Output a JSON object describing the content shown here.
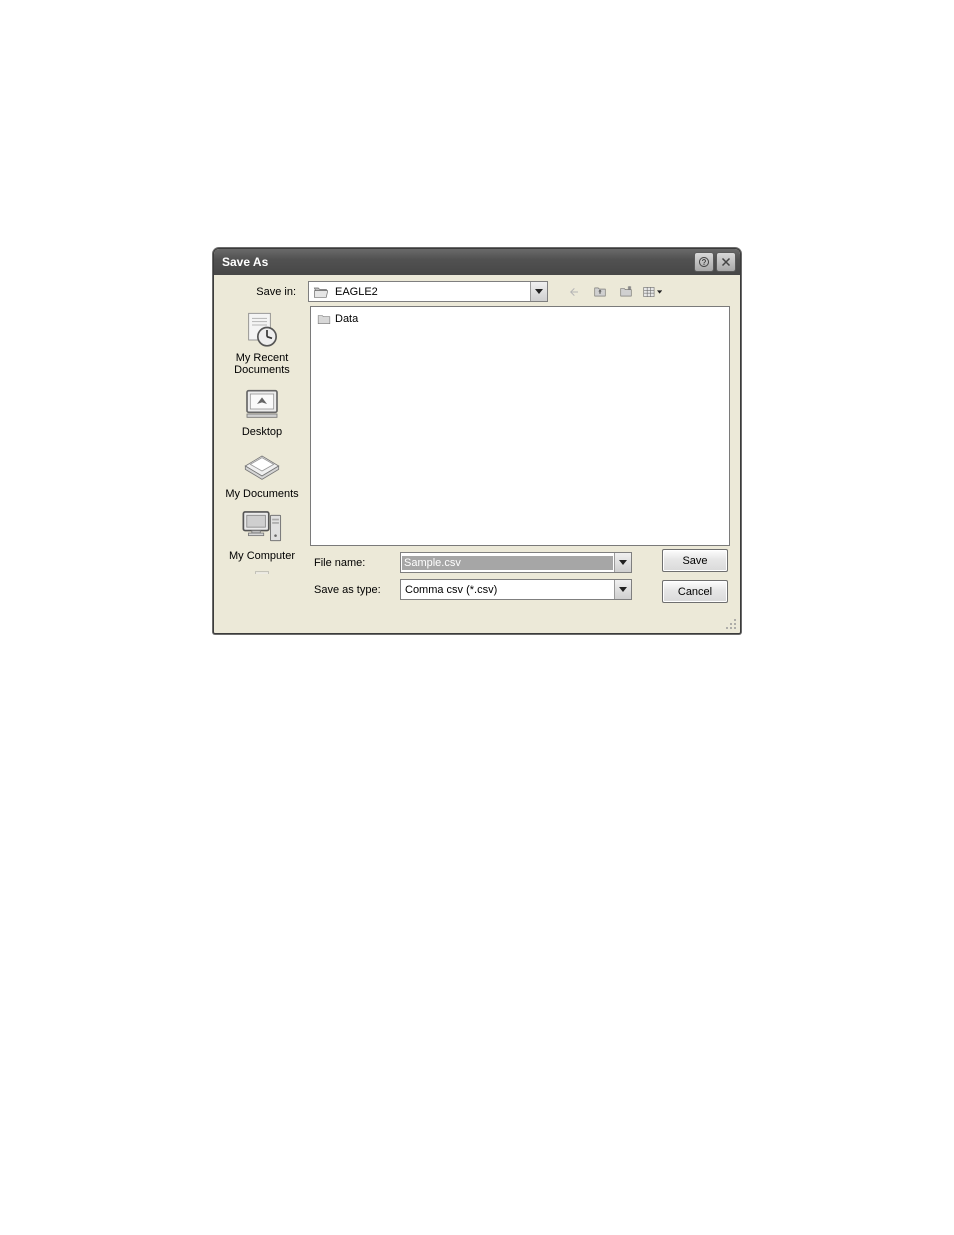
{
  "dialog": {
    "title": "Save As",
    "help_tooltip": "Help",
    "close_tooltip": "Close"
  },
  "top": {
    "save_in_label": "Save in:",
    "location": "EAGLE2"
  },
  "toolbar": {
    "back": "Back",
    "up": "Up One Level",
    "new_folder": "Create New Folder",
    "views": "Views"
  },
  "places": {
    "recent": "My Recent Documents",
    "desktop": "Desktop",
    "documents": "My Documents",
    "computer": "My Computer"
  },
  "files": {
    "items": [
      {
        "name": "Data"
      }
    ]
  },
  "form": {
    "file_name_label": "File name:",
    "file_name_value": "Sample.csv",
    "save_type_label": "Save as type:",
    "save_type_value": "Comma csv (*.csv)"
  },
  "buttons": {
    "save": "Save",
    "cancel": "Cancel"
  }
}
